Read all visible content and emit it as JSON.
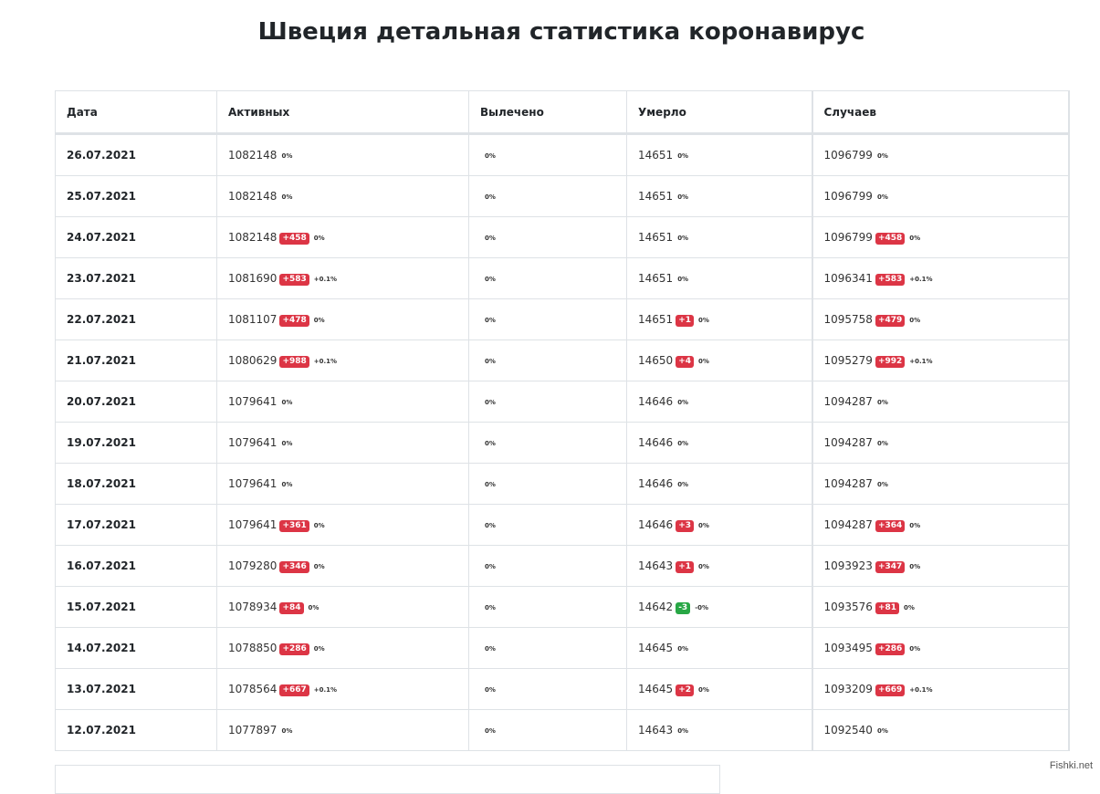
{
  "page": {
    "title": "Швеция детальная статистика коронавирус",
    "watermark": "Fishki.net"
  },
  "table": {
    "headers": [
      "Дата",
      "Активных",
      "Вылечено",
      "Умерло",
      "Случаев"
    ],
    "rows": [
      {
        "date": "26.07.2021",
        "active": {
          "value": "1082148",
          "delta": "",
          "delta_color": "",
          "pct": "0%"
        },
        "recovered": {
          "value": "",
          "pct": "0%"
        },
        "deaths": {
          "value": "14651",
          "delta": "",
          "delta_color": "",
          "pct": "0%"
        },
        "cases": {
          "value": "1096799",
          "delta": "",
          "delta_color": "",
          "pct": "0%"
        }
      },
      {
        "date": "25.07.2021",
        "active": {
          "value": "1082148",
          "delta": "",
          "delta_color": "",
          "pct": "0%"
        },
        "recovered": {
          "value": "",
          "pct": "0%"
        },
        "deaths": {
          "value": "14651",
          "delta": "",
          "delta_color": "",
          "pct": "0%"
        },
        "cases": {
          "value": "1096799",
          "delta": "",
          "delta_color": "",
          "pct": "0%"
        }
      },
      {
        "date": "24.07.2021",
        "active": {
          "value": "1082148",
          "delta": "+458",
          "delta_color": "red",
          "pct": "0%"
        },
        "recovered": {
          "value": "",
          "pct": "0%"
        },
        "deaths": {
          "value": "14651",
          "delta": "",
          "delta_color": "",
          "pct": "0%"
        },
        "cases": {
          "value": "1096799",
          "delta": "+458",
          "delta_color": "red",
          "pct": "0%"
        }
      },
      {
        "date": "23.07.2021",
        "active": {
          "value": "1081690",
          "delta": "+583",
          "delta_color": "red",
          "pct": "+0.1%"
        },
        "recovered": {
          "value": "",
          "pct": "0%"
        },
        "deaths": {
          "value": "14651",
          "delta": "",
          "delta_color": "",
          "pct": "0%"
        },
        "cases": {
          "value": "1096341",
          "delta": "+583",
          "delta_color": "red",
          "pct": "+0.1%"
        }
      },
      {
        "date": "22.07.2021",
        "active": {
          "value": "1081107",
          "delta": "+478",
          "delta_color": "red",
          "pct": "0%"
        },
        "recovered": {
          "value": "",
          "pct": "0%"
        },
        "deaths": {
          "value": "14651",
          "delta": "+1",
          "delta_color": "red",
          "pct": "0%"
        },
        "cases": {
          "value": "1095758",
          "delta": "+479",
          "delta_color": "red",
          "pct": "0%"
        }
      },
      {
        "date": "21.07.2021",
        "active": {
          "value": "1080629",
          "delta": "+988",
          "delta_color": "red",
          "pct": "+0.1%"
        },
        "recovered": {
          "value": "",
          "pct": "0%"
        },
        "deaths": {
          "value": "14650",
          "delta": "+4",
          "delta_color": "red",
          "pct": "0%"
        },
        "cases": {
          "value": "1095279",
          "delta": "+992",
          "delta_color": "red",
          "pct": "+0.1%"
        }
      },
      {
        "date": "20.07.2021",
        "active": {
          "value": "1079641",
          "delta": "",
          "delta_color": "",
          "pct": "0%"
        },
        "recovered": {
          "value": "",
          "pct": "0%"
        },
        "deaths": {
          "value": "14646",
          "delta": "",
          "delta_color": "",
          "pct": "0%"
        },
        "cases": {
          "value": "1094287",
          "delta": "",
          "delta_color": "",
          "pct": "0%"
        }
      },
      {
        "date": "19.07.2021",
        "active": {
          "value": "1079641",
          "delta": "",
          "delta_color": "",
          "pct": "0%"
        },
        "recovered": {
          "value": "",
          "pct": "0%"
        },
        "deaths": {
          "value": "14646",
          "delta": "",
          "delta_color": "",
          "pct": "0%"
        },
        "cases": {
          "value": "1094287",
          "delta": "",
          "delta_color": "",
          "pct": "0%"
        }
      },
      {
        "date": "18.07.2021",
        "active": {
          "value": "1079641",
          "delta": "",
          "delta_color": "",
          "pct": "0%"
        },
        "recovered": {
          "value": "",
          "pct": "0%"
        },
        "deaths": {
          "value": "14646",
          "delta": "",
          "delta_color": "",
          "pct": "0%"
        },
        "cases": {
          "value": "1094287",
          "delta": "",
          "delta_color": "",
          "pct": "0%"
        }
      },
      {
        "date": "17.07.2021",
        "active": {
          "value": "1079641",
          "delta": "+361",
          "delta_color": "red",
          "pct": "0%"
        },
        "recovered": {
          "value": "",
          "pct": "0%"
        },
        "deaths": {
          "value": "14646",
          "delta": "+3",
          "delta_color": "red",
          "pct": "0%"
        },
        "cases": {
          "value": "1094287",
          "delta": "+364",
          "delta_color": "red",
          "pct": "0%"
        }
      },
      {
        "date": "16.07.2021",
        "active": {
          "value": "1079280",
          "delta": "+346",
          "delta_color": "red",
          "pct": "0%"
        },
        "recovered": {
          "value": "",
          "pct": "0%"
        },
        "deaths": {
          "value": "14643",
          "delta": "+1",
          "delta_color": "red",
          "pct": "0%"
        },
        "cases": {
          "value": "1093923",
          "delta": "+347",
          "delta_color": "red",
          "pct": "0%"
        }
      },
      {
        "date": "15.07.2021",
        "active": {
          "value": "1078934",
          "delta": "+84",
          "delta_color": "red",
          "pct": "0%"
        },
        "recovered": {
          "value": "",
          "pct": "0%"
        },
        "deaths": {
          "value": "14642",
          "delta": "-3",
          "delta_color": "green",
          "pct": "-0%"
        },
        "cases": {
          "value": "1093576",
          "delta": "+81",
          "delta_color": "red",
          "pct": "0%"
        }
      },
      {
        "date": "14.07.2021",
        "active": {
          "value": "1078850",
          "delta": "+286",
          "delta_color": "red",
          "pct": "0%"
        },
        "recovered": {
          "value": "",
          "pct": "0%"
        },
        "deaths": {
          "value": "14645",
          "delta": "",
          "delta_color": "",
          "pct": "0%"
        },
        "cases": {
          "value": "1093495",
          "delta": "+286",
          "delta_color": "red",
          "pct": "0%"
        }
      },
      {
        "date": "13.07.2021",
        "active": {
          "value": "1078564",
          "delta": "+667",
          "delta_color": "red",
          "pct": "+0.1%"
        },
        "recovered": {
          "value": "",
          "pct": "0%"
        },
        "deaths": {
          "value": "14645",
          "delta": "+2",
          "delta_color": "red",
          "pct": "0%"
        },
        "cases": {
          "value": "1093209",
          "delta": "+669",
          "delta_color": "red",
          "pct": "+0.1%"
        }
      },
      {
        "date": "12.07.2021",
        "active": {
          "value": "1077897",
          "delta": "",
          "delta_color": "",
          "pct": "0%"
        },
        "recovered": {
          "value": "",
          "pct": "0%"
        },
        "deaths": {
          "value": "14643",
          "delta": "",
          "delta_color": "",
          "pct": "0%"
        },
        "cases": {
          "value": "1092540",
          "delta": "",
          "delta_color": "",
          "pct": "0%"
        }
      }
    ]
  },
  "colors": {
    "badge_red": "#dc3545",
    "badge_green": "#28a745",
    "border": "#dee2e6",
    "text": "#212529"
  }
}
